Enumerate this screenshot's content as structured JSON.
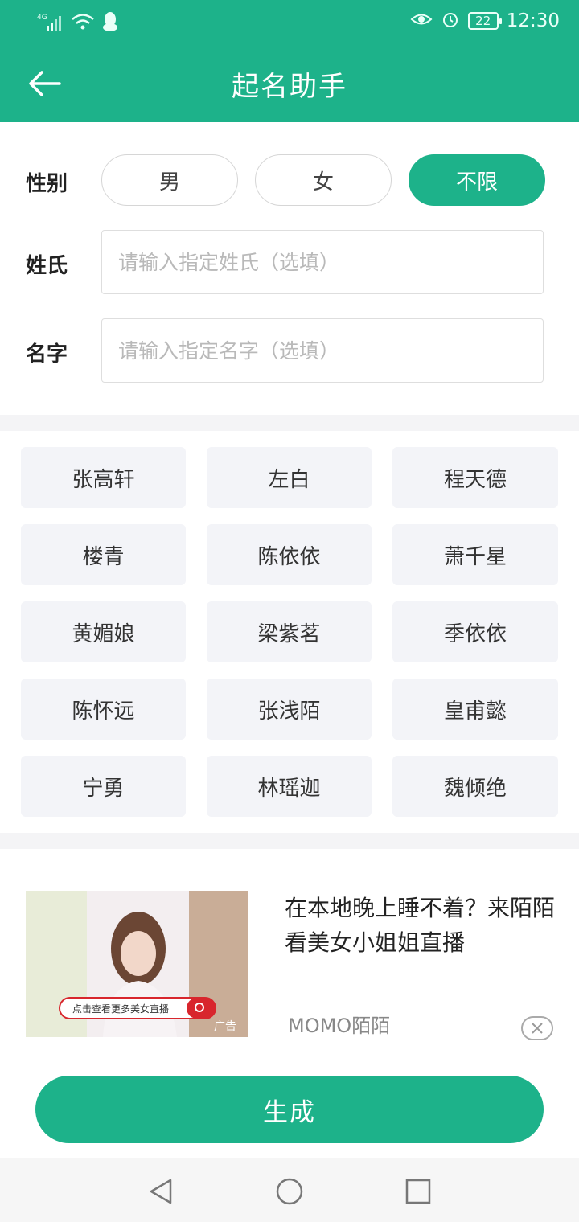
{
  "status_bar": {
    "network": "4G",
    "battery": "22",
    "time": "12:30"
  },
  "header": {
    "title": "起名助手"
  },
  "form": {
    "gender_label": "性别",
    "gender_options": [
      "男",
      "女",
      "不限"
    ],
    "gender_selected": "不限",
    "surname_label": "姓氏",
    "surname_placeholder": "请输入指定姓氏（选填）",
    "name_label": "名字",
    "name_placeholder": "请输入指定名字（选填）"
  },
  "names": [
    "张高轩",
    "左白",
    "程天德",
    "楼青",
    "陈依依",
    "萧千星",
    "黄媚娘",
    "梁紫茗",
    "季依依",
    "陈怀远",
    "张浅陌",
    "皇甫懿",
    "宁勇",
    "林瑶迦",
    "魏倾绝"
  ],
  "ad": {
    "image_banner": "点击查看更多美女直播",
    "image_badge": "广告",
    "text": "在本地晚上睡不着？来陌陌看美女小姐姐直播",
    "source": "MOMO陌陌"
  },
  "generate_label": "生成",
  "colors": {
    "accent": "#1db28a",
    "chip_bg": "#f3f4f8"
  }
}
